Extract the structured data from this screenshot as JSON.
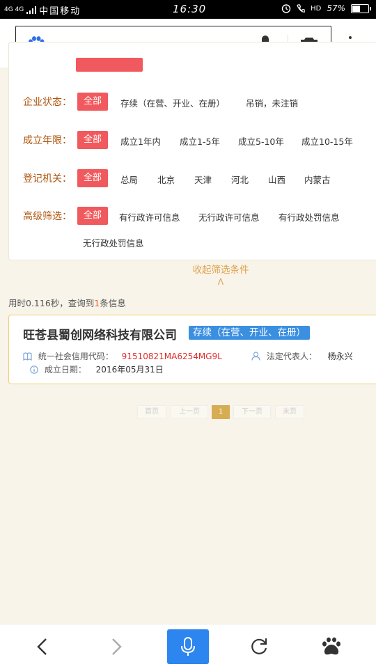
{
  "status_bar": {
    "network": "4G 4G",
    "carrier": "中国移动",
    "time": "16:30",
    "hd": "HD",
    "battery": "57%",
    "battery_level": 0.57
  },
  "search": {
    "placeholder": ""
  },
  "filters": {
    "rows": [
      {
        "label": "企业状态：",
        "all": "全部",
        "options": [
          "存续（在营、开业、在册）",
          "吊销，未注销"
        ]
      },
      {
        "label": "成立年限：",
        "all": "全部",
        "options": [
          "成立1年内",
          "成立1-5年",
          "成立5-10年",
          "成立10-15年"
        ]
      },
      {
        "label": "登记机关：",
        "all": "全部",
        "options": [
          "总局",
          "北京",
          "天津",
          "河北",
          "山西",
          "内蒙古"
        ]
      },
      {
        "label": "高级筛选：",
        "all": "全部",
        "options": [
          "有行政许可信息",
          "无行政许可信息",
          "有行政处罚信息",
          "无行政处罚信息"
        ]
      }
    ],
    "collapse_label": "收起筛选条件",
    "collapse_chevron": "Λ"
  },
  "result_info": {
    "prefix": "用时0.116秒，查询到",
    "count": "1",
    "suffix": "条信息"
  },
  "result": {
    "company_name": "旺苍县蜀创网络科技有限公司",
    "status": "存续（在营、开业、在册）",
    "credit_code_label": "统一社会信用代码：",
    "credit_code": "91510821MA6254MG9L",
    "legal_rep_label": "法定代表人：",
    "legal_rep": "杨永兴",
    "date_label": "成立日期：",
    "date": "2016年05月31日"
  },
  "pagination": {
    "first": "首页",
    "prev": "上一页",
    "current": "1",
    "next": "下一页",
    "last": "末页"
  },
  "colors": {
    "accent_red": "#f0595d",
    "label_brown": "#b0560e",
    "status_blue": "#3b8fe0",
    "voice_blue": "#2d86ef"
  }
}
